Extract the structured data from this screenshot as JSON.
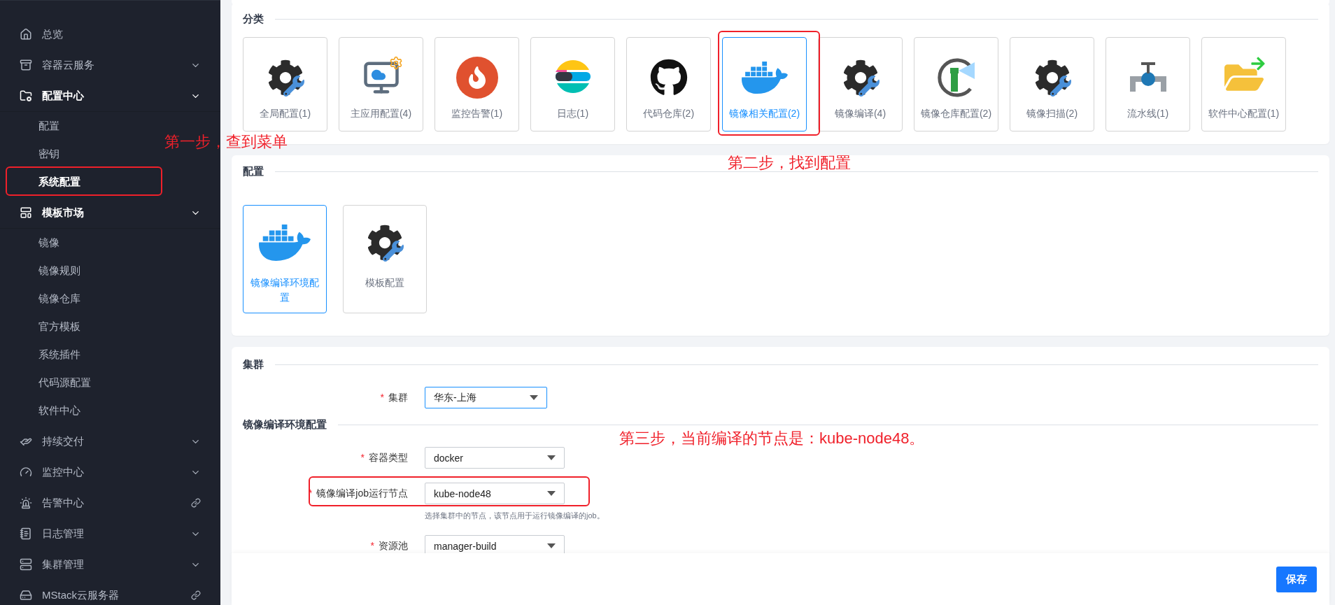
{
  "sidebar": {
    "items": [
      {
        "label": "总览",
        "kind": "plain"
      },
      {
        "label": "容器云服务",
        "kind": "menu",
        "expanded": false
      },
      {
        "label": "配置中心",
        "kind": "menu",
        "expanded": true,
        "children": [
          {
            "label": "配置",
            "selected": false
          },
          {
            "label": "密钥",
            "selected": false
          },
          {
            "label": "系统配置",
            "selected": true
          }
        ]
      },
      {
        "label": "模板市场",
        "kind": "menu",
        "expanded": true,
        "children": [
          {
            "label": "镜像",
            "selected": false
          },
          {
            "label": "镜像规则",
            "selected": false
          },
          {
            "label": "镜像仓库",
            "selected": false
          },
          {
            "label": "官方模板",
            "selected": false
          },
          {
            "label": "系统插件",
            "selected": false
          },
          {
            "label": "代码源配置",
            "selected": false
          },
          {
            "label": "软件中心",
            "selected": false
          }
        ]
      },
      {
        "label": "持续交付",
        "kind": "menu",
        "expanded": false
      },
      {
        "label": "监控中心",
        "kind": "menu",
        "expanded": false
      },
      {
        "label": "告警中心",
        "kind": "link"
      },
      {
        "label": "日志管理",
        "kind": "menu",
        "expanded": false
      },
      {
        "label": "集群管理",
        "kind": "menu",
        "expanded": false
      },
      {
        "label": "MStack云服务器",
        "kind": "link"
      }
    ]
  },
  "categories": {
    "title": "分类",
    "items": [
      {
        "label": "全局配置(1)",
        "selected": false
      },
      {
        "label": "主应用配置(4)",
        "selected": false
      },
      {
        "label": "监控告警(1)",
        "selected": false
      },
      {
        "label": "日志(1)",
        "selected": false
      },
      {
        "label": "代码仓库(2)",
        "selected": false
      },
      {
        "label": "镜像相关配置(2)",
        "selected": true
      },
      {
        "label": "镜像编译(4)",
        "selected": false
      },
      {
        "label": "镜像仓库配置(2)",
        "selected": false
      },
      {
        "label": "镜像扫描(2)",
        "selected": false
      },
      {
        "label": "流水线(1)",
        "selected": false
      },
      {
        "label": "软件中心配置(1)",
        "selected": false
      }
    ]
  },
  "configs": {
    "title": "配置",
    "items": [
      {
        "label": "镜像编译环境配置",
        "selected": true
      },
      {
        "label": "模板配置",
        "selected": false
      }
    ]
  },
  "form": {
    "sections": [
      {
        "title": "集群",
        "fields": [
          {
            "required_mark": "*",
            "label": "集群",
            "value": "华东-上海",
            "focused": true
          }
        ]
      },
      {
        "title": "镜像编译环境配置",
        "fields": [
          {
            "required_mark": "*",
            "label": "容器类型",
            "value": "docker",
            "focused": false
          },
          {
            "required_mark": "*",
            "label": "镜像编译job运行节点",
            "value": "kube-node48",
            "hint": "选择集群中的节点，该节点用于运行镜像编译的job。",
            "focused": false
          },
          {
            "required_mark": "*",
            "label": "资源池",
            "value": "manager-build",
            "focused": false
          }
        ]
      }
    ]
  },
  "footer": {
    "save_button": "保存"
  },
  "annotations": [
    {
      "kind": "frame"
    },
    {
      "kind": "frame"
    },
    {
      "kind": "frame"
    },
    {
      "kind": "note",
      "text": "第一步，查到菜单"
    },
    {
      "kind": "note",
      "text": "第二步，找到配置"
    },
    {
      "kind": "note",
      "text": "第三步，当前编译的节点是：kube-node48。"
    }
  ]
}
